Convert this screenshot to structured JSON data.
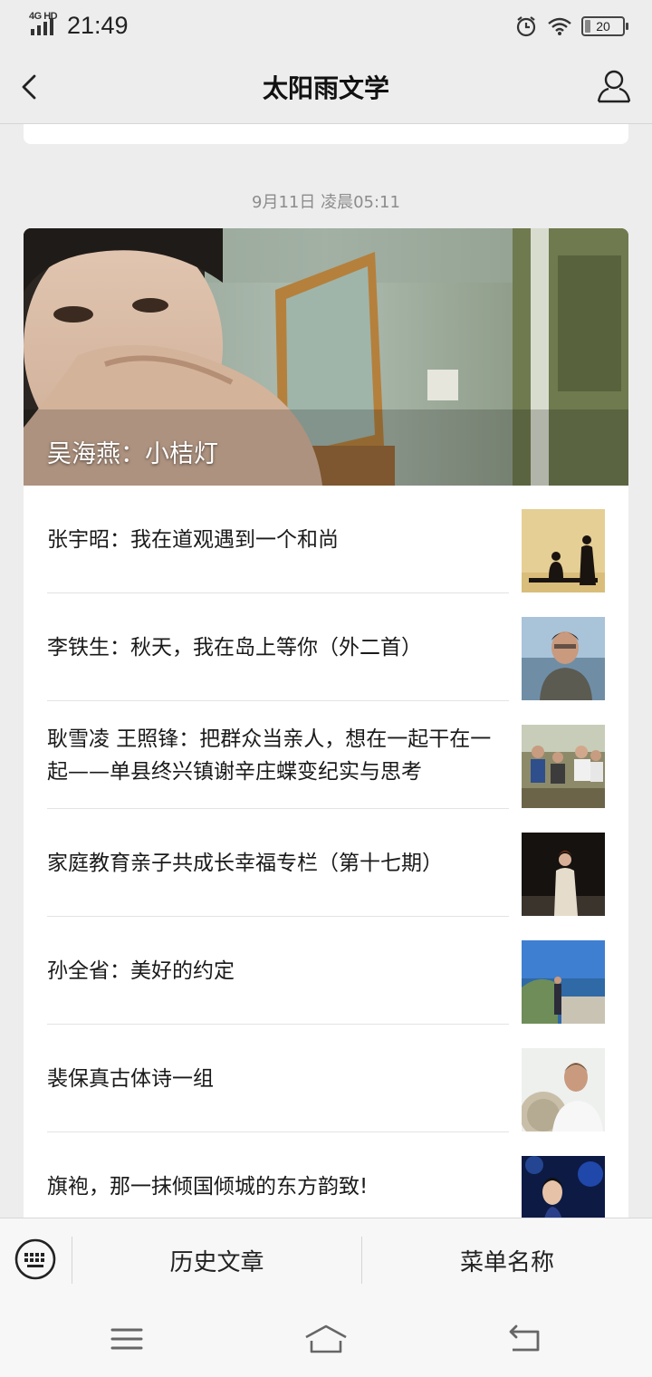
{
  "status_bar": {
    "network": "4G HD",
    "time": "21:49",
    "battery": "20",
    "icons": [
      "signal-icon",
      "alarm-icon",
      "wifi-icon",
      "battery-icon"
    ]
  },
  "nav": {
    "title": "太阳雨文学",
    "back_icon": "chevron-left-icon",
    "profile_icon": "person-icon"
  },
  "feed": {
    "date": "9月11日 凌晨05:11",
    "hero_title": "吴海燕：小桔灯",
    "articles": [
      {
        "title": "张宇昭：我在道观遇到一个和尚"
      },
      {
        "title": "李铁生：秋天，我在岛上等你（外二首）"
      },
      {
        "title": "耿雪凌 王照锋：把群众当亲人，想在一起干在一起——单县终兴镇谢辛庄蝶变纪实与思考"
      },
      {
        "title": "家庭教育亲子共成长幸福专栏（第十七期）"
      },
      {
        "title": "孙全省：美好的约定"
      },
      {
        "title": "裴保真古体诗一组"
      },
      {
        "title": "旗袍，那一抹倾国倾城的东方韵致!"
      }
    ]
  },
  "menu": {
    "keyboard_icon": "keyboard-icon",
    "items": [
      "历史文章",
      "菜单名称"
    ]
  },
  "system_nav": {
    "icons": [
      "menu-lines-icon",
      "home-icon",
      "back-arrow-icon"
    ]
  },
  "colors": {
    "background": "#ededed",
    "card": "#ffffff",
    "date_text": "#8c8c8c"
  }
}
